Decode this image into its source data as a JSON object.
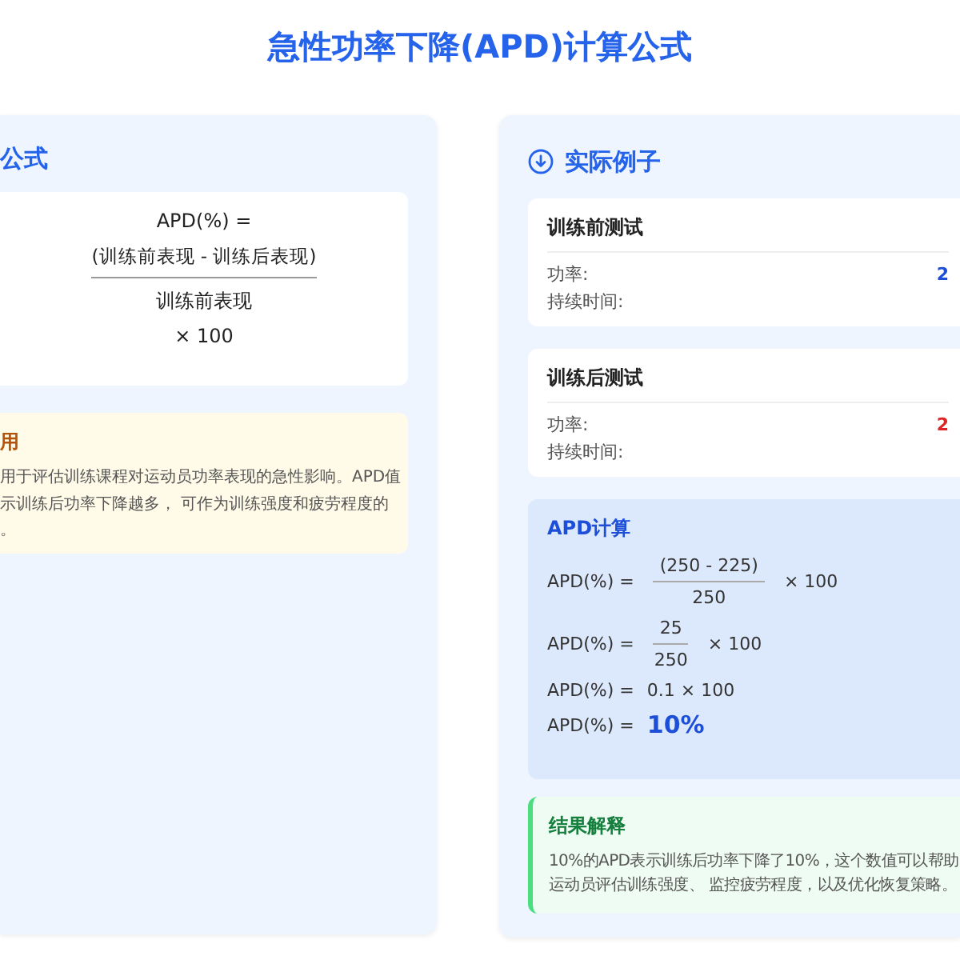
{
  "title": "急性功率下降(APD)计算公式",
  "formula_panel": {
    "heading": "公式",
    "formula": {
      "lhs": "APD(%) =",
      "numerator": "(训练前表现 - 训练后表现)",
      "denominator": "训练前表现",
      "multiplier": "× 100"
    },
    "note": {
      "title": "用",
      "lines": [
        "用于评估训练课程对运动员功率表现的急性影响。APD值",
        "示训练后功率下降越多， 可作为训练强度和疲劳程度的",
        "。"
      ]
    }
  },
  "example_panel": {
    "heading": "实际例子",
    "tests": [
      {
        "title": "训练前测试",
        "rows": [
          {
            "label": "功率:",
            "value": "2",
            "color": "#1d4ed8"
          },
          {
            "label": "持续时间:"
          }
        ]
      },
      {
        "title": "训练后测试",
        "rows": [
          {
            "label": "功率:",
            "value": "2",
            "color": "#dc2626"
          },
          {
            "label": "持续时间:"
          }
        ]
      }
    ],
    "calculation": {
      "title": "APD计算",
      "steps": [
        {
          "kind": "fraction",
          "lhs": "APD(%) =",
          "numerator": "(250 - 225)",
          "denominator": "250",
          "multiplier": "× 100"
        },
        {
          "kind": "fraction",
          "lhs": "APD(%) =",
          "numerator": "25",
          "denominator": "250",
          "multiplier": "× 100"
        },
        {
          "kind": "plain",
          "lhs": "APD(%) =",
          "expr": "0.1 × 100"
        },
        {
          "kind": "result",
          "lhs": "APD(%) =",
          "expr": "10%"
        }
      ]
    },
    "interpretation": {
      "title": "结果解释",
      "lines": [
        "10%的APD表示训练后功率下降了10%，这个数值可以帮助",
        "运动员评估训练强度、 监控疲劳程度，以及优化恢复策略。"
      ]
    }
  }
}
